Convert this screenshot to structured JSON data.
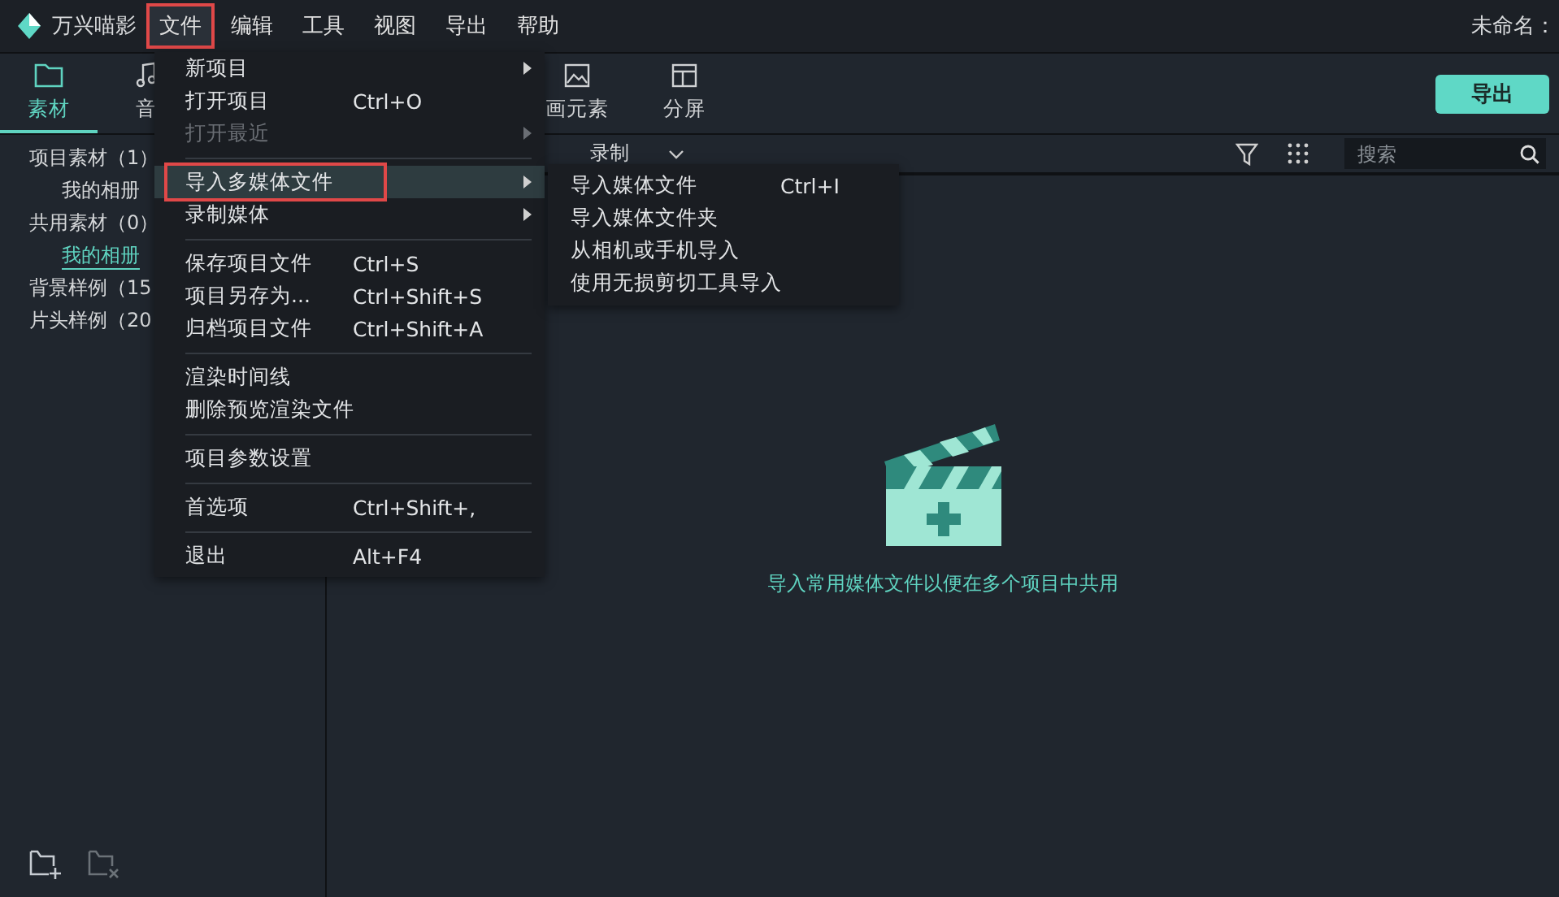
{
  "app": {
    "name": "万兴喵影",
    "document_title": "未命名："
  },
  "menubar": [
    {
      "label": "文件",
      "selected": true,
      "highlighted": true
    },
    {
      "label": "编辑",
      "selected": false,
      "highlighted": false
    },
    {
      "label": "工具",
      "selected": false,
      "highlighted": false
    },
    {
      "label": "视图",
      "selected": false,
      "highlighted": false
    },
    {
      "label": "导出",
      "selected": false,
      "highlighted": false
    },
    {
      "label": "帮助",
      "selected": false,
      "highlighted": false
    }
  ],
  "export_button": "导出",
  "left_tabs": [
    {
      "label": "素材",
      "selected": true
    },
    {
      "label": "音",
      "selected": false
    }
  ],
  "right_tabs": [
    {
      "label": "画元素",
      "selected": false
    },
    {
      "label": "分屏",
      "selected": false
    }
  ],
  "tree": [
    {
      "label": "项目素材（1）",
      "selected": false,
      "children": [
        {
          "label": "我的相册",
          "selected": false
        }
      ]
    },
    {
      "label": "共用素材（0）",
      "selected": false,
      "children": [
        {
          "label": "我的相册",
          "selected": true
        }
      ]
    },
    {
      "label": "背景样例（15",
      "selected": false
    },
    {
      "label": "片头样例（20",
      "selected": false
    }
  ],
  "toolbar": {
    "record": "录制",
    "search": {
      "placeholder": "搜索"
    }
  },
  "empty_state": "导入常用媒体文件以便在多个项目中共用",
  "file_menu": [
    {
      "kind": "item",
      "label": "新项目",
      "submenu": true,
      "disabled": false,
      "selected": false,
      "highlighted": false
    },
    {
      "kind": "item",
      "label": "打开项目",
      "shortcut": "Ctrl+O",
      "submenu": false,
      "disabled": false,
      "selected": false,
      "highlighted": false
    },
    {
      "kind": "item",
      "label": "打开最近",
      "submenu": true,
      "disabled": true,
      "selected": false,
      "highlighted": false
    },
    {
      "kind": "separator"
    },
    {
      "kind": "item",
      "label": "导入多媒体文件",
      "submenu": true,
      "disabled": false,
      "selected": true,
      "highlighted": true
    },
    {
      "kind": "item",
      "label": "录制媒体",
      "submenu": true,
      "disabled": false,
      "selected": false,
      "highlighted": false
    },
    {
      "kind": "separator"
    },
    {
      "kind": "item",
      "label": "保存项目文件",
      "shortcut": "Ctrl+S",
      "submenu": false,
      "disabled": false,
      "selected": false,
      "highlighted": false
    },
    {
      "kind": "item",
      "label": "项目另存为...",
      "shortcut": "Ctrl+Shift+S",
      "submenu": false,
      "disabled": false,
      "selected": false,
      "highlighted": false
    },
    {
      "kind": "item",
      "label": "归档项目文件",
      "shortcut": "Ctrl+Shift+A",
      "submenu": false,
      "disabled": false,
      "selected": false,
      "highlighted": false
    },
    {
      "kind": "separator"
    },
    {
      "kind": "item",
      "label": "渲染时间线",
      "submenu": false,
      "disabled": false,
      "selected": false,
      "highlighted": false
    },
    {
      "kind": "item",
      "label": "删除预览渲染文件",
      "submenu": false,
      "disabled": false,
      "selected": false,
      "highlighted": false
    },
    {
      "kind": "separator"
    },
    {
      "kind": "item",
      "label": "项目参数设置",
      "submenu": false,
      "disabled": false,
      "selected": false,
      "highlighted": false
    },
    {
      "kind": "separator"
    },
    {
      "kind": "item",
      "label": "首选项",
      "shortcut": "Ctrl+Shift+,",
      "submenu": false,
      "disabled": false,
      "selected": false,
      "highlighted": false
    },
    {
      "kind": "separator"
    },
    {
      "kind": "item",
      "label": "退出",
      "shortcut": "Alt+F4",
      "submenu": false,
      "disabled": false,
      "selected": false,
      "highlighted": false
    }
  ],
  "import_submenu": [
    {
      "label": "导入媒体文件",
      "shortcut": "Ctrl+I"
    },
    {
      "label": "导入媒体文件夹"
    },
    {
      "label": "从相机或手机导入"
    },
    {
      "label": "使用无损剪切工具导入"
    }
  ],
  "bottom_actions": [
    {
      "disabled": false
    },
    {
      "disabled": true
    }
  ]
}
